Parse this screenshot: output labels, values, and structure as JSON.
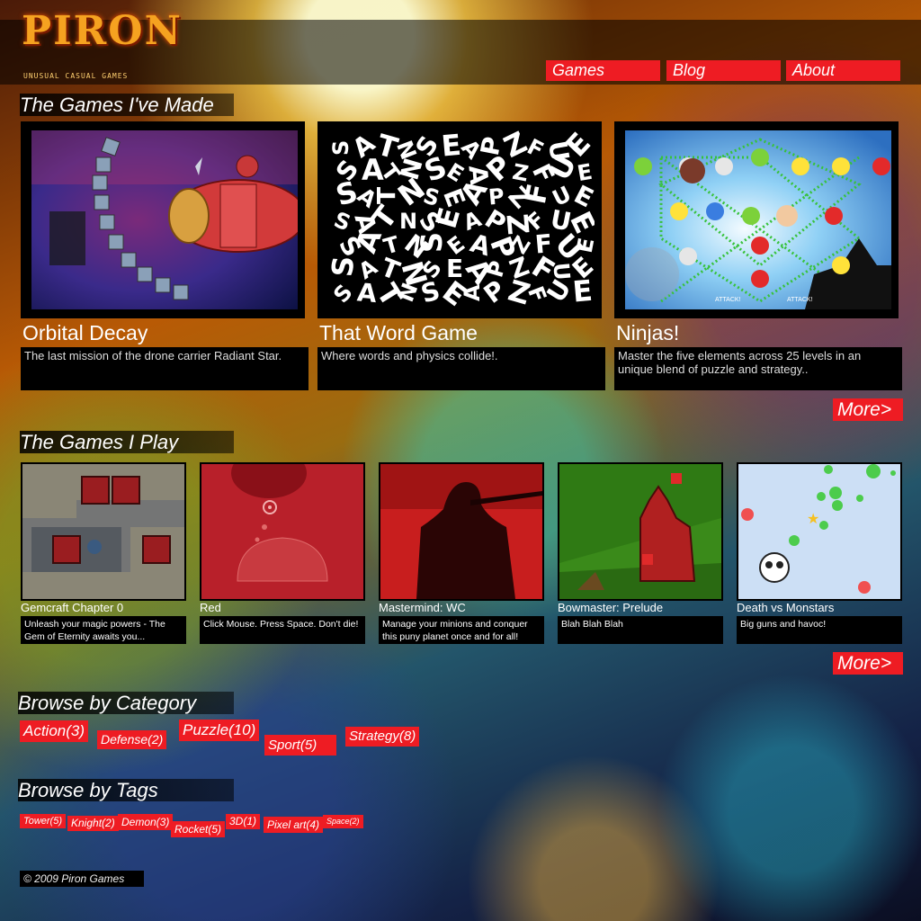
{
  "site": {
    "logo": "PIRON",
    "tagline": "UNUSUAL CASUAL GAMES",
    "footer": "© 2009 Piron Games"
  },
  "nav": [
    {
      "label": "Games"
    },
    {
      "label": "Blog"
    },
    {
      "label": "About"
    }
  ],
  "sections": {
    "made_title": "The Games I've Made",
    "play_title": "The Games I Play",
    "category_title": "Browse by Category",
    "tags_title": "Browse by Tags",
    "more_label": "More>"
  },
  "made_games": [
    {
      "title": "Orbital Decay",
      "desc": "The last mission of the drone carrier Radiant Star."
    },
    {
      "title": "That Word Game",
      "desc": "Where words and physics collide!."
    },
    {
      "title": "Ninjas!",
      "desc": "Master the five elements across 25 levels in an unique blend of puzzle and strategy.."
    }
  ],
  "word_game_letters": "SATNSEAPZFUE",
  "ninja_hud": {
    "attack_left": "ATTACK!",
    "attack_right": "ATTACK!"
  },
  "played_games": [
    {
      "title": "Gemcraft Chapter 0",
      "desc": "Unleash your magic powers - The Gem of Eternity awaits you..."
    },
    {
      "title": "Red",
      "desc": "Click Mouse. Press Space. Don't die!"
    },
    {
      "title": "Mastermind: WC",
      "desc": "Manage your minions and conquer this puny planet once and for all!"
    },
    {
      "title": "Bowmaster: Prelude",
      "desc": "Blah Blah Blah"
    },
    {
      "title": "Death vs Monstars",
      "desc": "Big guns and havoc!"
    }
  ],
  "categories": [
    {
      "label": "Action(3)"
    },
    {
      "label": "Defense(2)"
    },
    {
      "label": "Puzzle(10)"
    },
    {
      "label": "Sport(5)"
    },
    {
      "label": "Strategy(8)"
    }
  ],
  "tags": [
    {
      "label": "Tower(5)"
    },
    {
      "label": "Knight(2)"
    },
    {
      "label": "Demon(3)"
    },
    {
      "label": "Rocket(5)"
    },
    {
      "label": "3D(1)"
    },
    {
      "label": "Pixel art(4)"
    },
    {
      "label": "Space(2)"
    }
  ],
  "colors": {
    "accent": "#ee1c23",
    "panel": "#000000",
    "logo": "#f5a220"
  }
}
